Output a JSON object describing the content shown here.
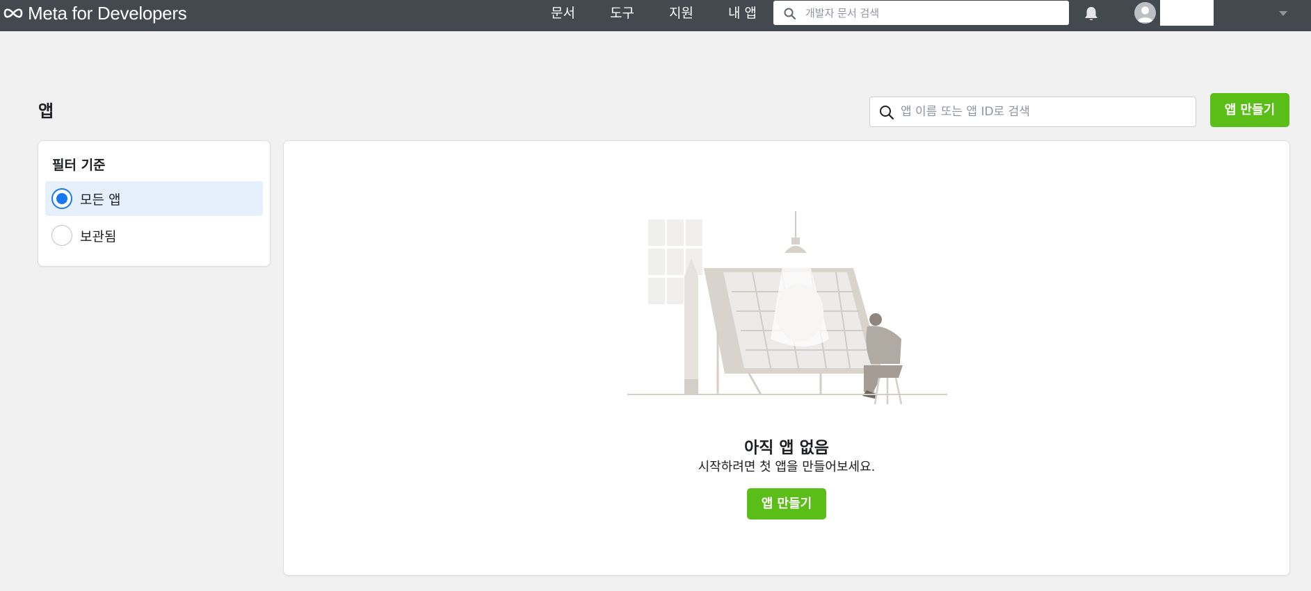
{
  "header": {
    "brand": "Meta for Developers",
    "nav": [
      "문서",
      "도구",
      "지원",
      "내 앱"
    ],
    "search_placeholder": "개발자 문서 검색"
  },
  "page": {
    "title": "앱",
    "search_placeholder": "앱 이름 또는 앱 ID로 검색",
    "create_button": "앱 만들기"
  },
  "filter": {
    "title": "필터 기준",
    "options": [
      {
        "label": "모든 앱",
        "selected": true
      },
      {
        "label": "보관됨",
        "selected": false
      }
    ]
  },
  "empty_state": {
    "title": "아직 앱 없음",
    "subtitle": "시작하려면 첫 앱을 만들어보세요.",
    "button": "앱 만들기"
  },
  "colors": {
    "topbar": "#444950",
    "accent_green": "#5bbd17",
    "radio_blue": "#1877f2",
    "selected_bg": "#e6f0fc"
  }
}
